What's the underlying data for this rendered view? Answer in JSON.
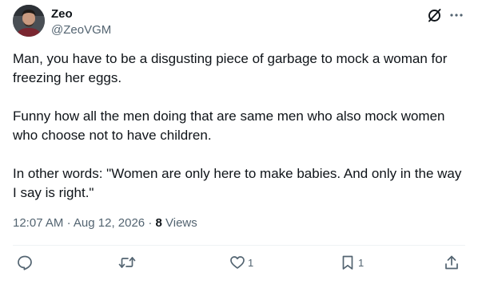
{
  "author": {
    "display_name": "Zeo",
    "handle": "@ZeoVGM"
  },
  "tweet": {
    "paragraphs": [
      "Man, you have to be a disgusting piece of garbage to mock a woman for freezing her eggs.",
      "Funny how all the men doing that are same men who also mock women who choose not to have children.",
      "In other words: \"Women are only here to make babies. And only in the way I say is right.\""
    ],
    "time": "12:07 AM",
    "separator": "·",
    "date": "Aug 12, 2026",
    "views_count": "8",
    "views_label": "Views"
  },
  "actions": {
    "reply_count": "",
    "repost_count": "",
    "like_count": "1",
    "bookmark_count": "1"
  },
  "icons": {
    "header": [
      "grok-icon",
      "more-icon"
    ],
    "actions": [
      "reply-icon",
      "repost-icon",
      "like-icon",
      "bookmark-icon",
      "share-icon"
    ]
  },
  "colors": {
    "text_primary": "#0f1419",
    "text_secondary": "#536471",
    "divider": "#eff3f4"
  }
}
